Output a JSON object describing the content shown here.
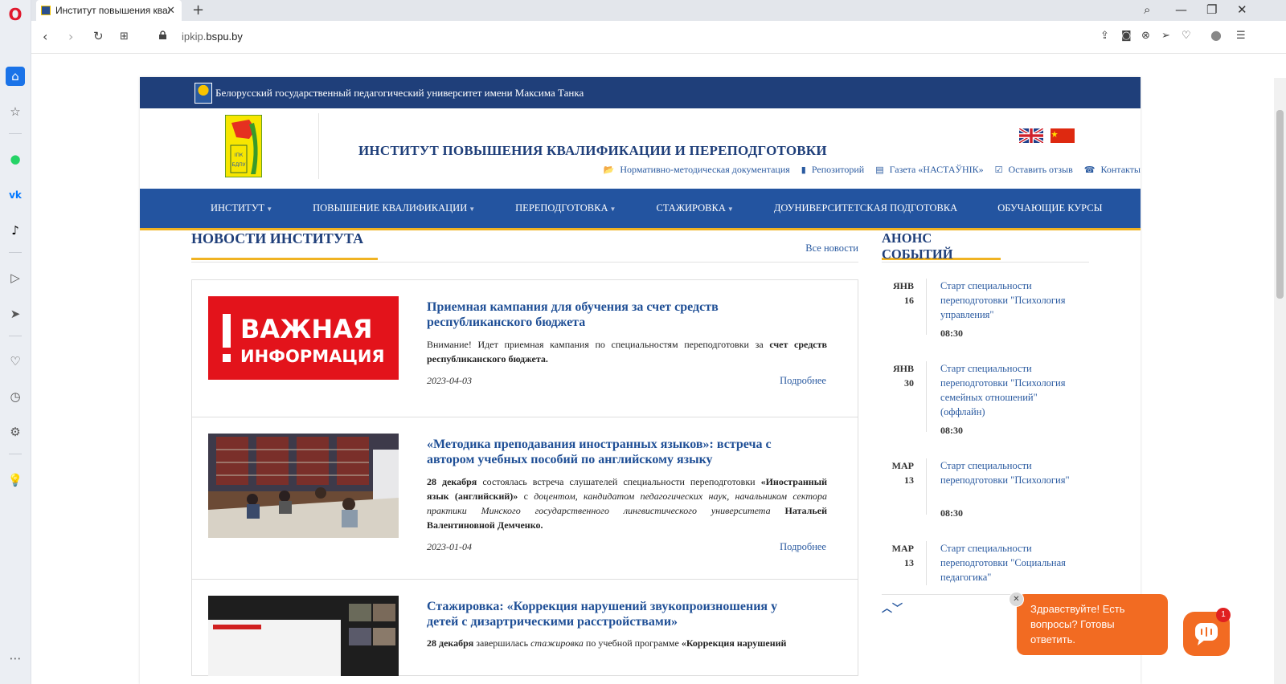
{
  "browser": {
    "tab_title": "Институт повышения квалификации и переподготовки",
    "tab_close": "✕",
    "new_tab": "+",
    "url_sub": "ipkip.",
    "url_domain": "bspu.by"
  },
  "site": {
    "university": "Белорусский государственный педагогический университет имени Максима Танка",
    "institute_title": "ИНСТИТУТ ПОВЫШЕНИЯ КВАЛИФИКАЦИИ И ПЕРЕПОДГОТОВКИ",
    "top_links": [
      {
        "label": "Нормативно-методическая документация",
        "icon": "folder-icon"
      },
      {
        "label": "Репозиторий",
        "icon": "book-icon"
      },
      {
        "label": "Газета «НАСТАЎНІК»",
        "icon": "newspaper-icon"
      },
      {
        "label": "Оставить отзыв",
        "icon": "check-icon"
      },
      {
        "label": "Контакты",
        "icon": "phone-icon"
      }
    ],
    "nav": [
      {
        "label": "ИНСТИТУТ",
        "dropdown": true
      },
      {
        "label": "ПОВЫШЕНИЕ КВАЛИФИКАЦИИ",
        "dropdown": true
      },
      {
        "label": "ПЕРЕПОДГОТОВКА",
        "dropdown": true
      },
      {
        "label": "СТАЖИРОВКА",
        "dropdown": true
      },
      {
        "label": "ДОУНИВЕРСИТЕТСКАЯ ПОДГОТОВКА",
        "dropdown": false
      },
      {
        "label": "ОБУЧАЮЩИЕ КУРСЫ",
        "dropdown": false
      }
    ]
  },
  "news": {
    "title": "НОВОСТИ ИНСТИТУТА",
    "all_link": "Все новости",
    "more_label": "Подробнее",
    "items": [
      {
        "title": "Приемная кампания для обучения за счет средств республиканского бюджета",
        "text_plain": "Внимание! Идет приемная кампания по специальностям переподготовки за ",
        "text_bold": "счет средств республиканского бюджета.",
        "date": "2023-04-03",
        "thumb_line1": "ВАЖНАЯ",
        "thumb_line2": "ИНФОРМАЦИЯ"
      },
      {
        "title": "«Методика преподавания иностранных языков»: встреча с автором учебных пособий по английскому языку",
        "text_b1": "28 декабря",
        "text_p1": " состоялась встреча слушателей специальности переподготовки ",
        "text_b2": "«Иностранный язык (английский)»",
        "text_p2": " с ",
        "text_i1": "доцентом, кандидатом педагогических наук, начальником сектора практики Минского государственного лингвистического университета",
        "text_b3": " Натальей Валентиновной Демченко.",
        "date": "2023-01-04"
      },
      {
        "title": "Стажировка: «Коррекция нарушений звукопроизношения у детей с дизартрическими расстройствами»",
        "text_b1": "28 декабря",
        "text_p1": " завершилась ",
        "text_i1": "стажировка",
        "text_p2": " по учебной программе ",
        "text_b2": "«Коррекция нарушений"
      }
    ]
  },
  "events": {
    "title": "АНОНС СОБЫТИЙ",
    "items": [
      {
        "month": "ЯНВ",
        "day": "16",
        "title": "Старт специальности переподготовки \"Психология управления\"",
        "time": "08:30"
      },
      {
        "month": "ЯНВ",
        "day": "30",
        "title": "Старт специальности переподготовки \"Психология семейных отношений\" (оффлайн)",
        "time": "08:30"
      },
      {
        "month": "МАР",
        "day": "13",
        "title": "Старт специальности переподготовки \"Психология\"",
        "time": "08:30"
      },
      {
        "month": "МАР",
        "day": "13",
        "title": "Старт специальности переподготовки \"Социальная педагогика\"",
        "time": ""
      }
    ],
    "arrows": "︿﹀"
  },
  "chat": {
    "message": "Здравствуйте! Есть вопросы? Готовы ответить.",
    "badge": "1",
    "close": "✕"
  },
  "colors": {
    "brand_blue": "#1f3f7a",
    "nav_blue": "#2354a0",
    "accent_gold": "#f0b323",
    "chat_orange": "#f26b22"
  }
}
